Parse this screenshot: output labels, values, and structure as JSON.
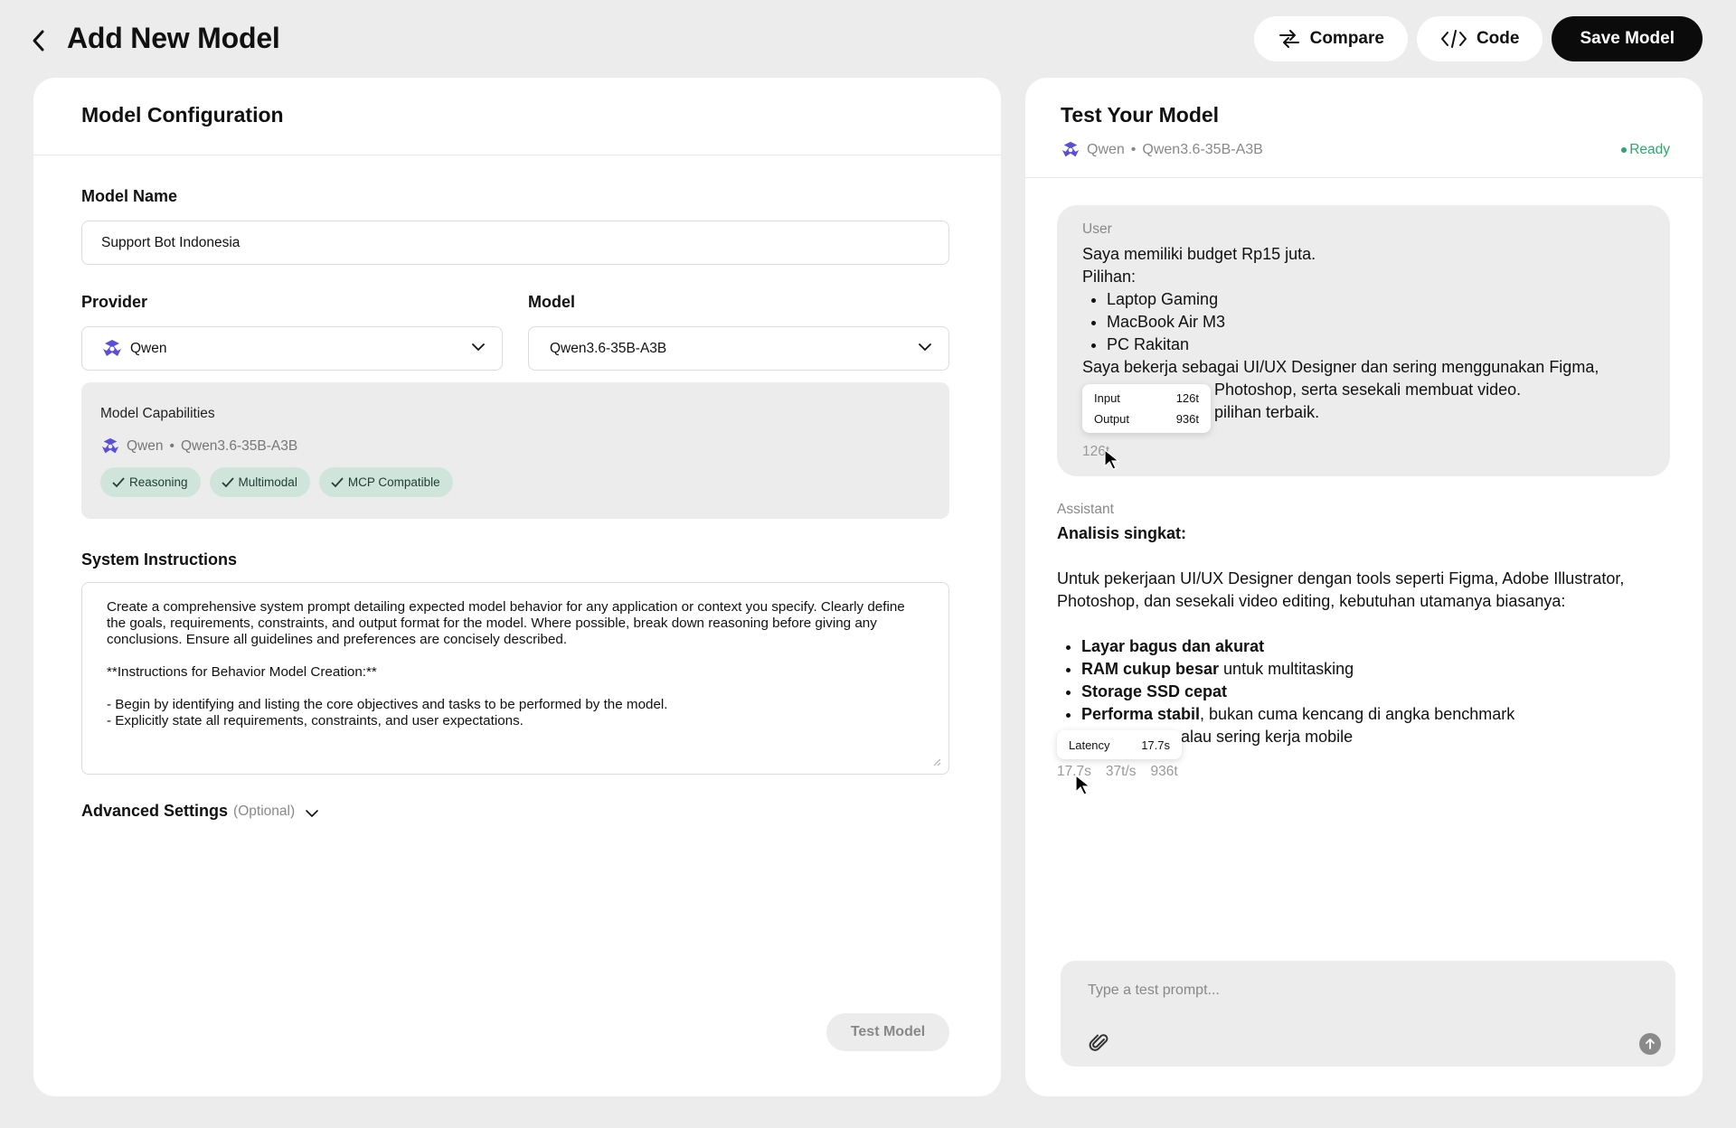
{
  "header": {
    "title": "Add New Model",
    "back_icon": "chevron-left-icon",
    "compare_label": "Compare",
    "code_label": "Code",
    "save_label": "Save Model"
  },
  "config": {
    "panel_title": "Model Configuration",
    "model_name_label": "Model Name",
    "model_name_value": "Support Bot Indonesia",
    "provider_label": "Provider",
    "provider_value": "Qwen",
    "model_label": "Model",
    "model_value": "Qwen3.6-35B-A3B",
    "capabilities": {
      "title": "Model Capabilities",
      "provider": "Qwen",
      "model": "Qwen3.6-35B-A3B",
      "badges": [
        "Reasoning",
        "Multimodal",
        "MCP Compatible"
      ]
    },
    "system_label": "System Instructions",
    "system_text": "Create a comprehensive system prompt detailing expected model behavior for any application or context you specify. Clearly define the goals, requirements, constraints, and output format for the model. Where possible, break down reasoning before giving any conclusions. Ensure all guidelines and preferences are concisely described.\n\n**Instructions for Behavior Model Creation:**\n\n- Begin by identifying and listing the core objectives and tasks to be performed by the model.\n- Explicitly state all requirements, constraints, and user expectations.",
    "advanced_label": "Advanced Settings",
    "advanced_optional": "(Optional)",
    "test_button": "Test Model"
  },
  "test": {
    "title": "Test Your Model",
    "provider": "Qwen",
    "model": "Qwen3.6-35B-A3B",
    "status": "Ready",
    "user": {
      "role": "User",
      "line1": "Saya memiliki budget Rp15 juta.",
      "line2": "Pilihan:",
      "items": [
        "Laptop Gaming",
        "MacBook Air M3",
        "PC Rakitan"
      ],
      "line3": "Saya bekerja sebagai UI/UX Designer dan sering menggunakan Figma,",
      "line4": "Photoshop, serta sesekali membuat video.",
      "line5": "pilihan terbaik.",
      "tokens": "126t",
      "tooltip": {
        "input_label": "Input",
        "input_value": "126t",
        "output_label": "Output",
        "output_value": "936t"
      }
    },
    "assistant": {
      "role": "Assistant",
      "heading": "Analisis singkat:",
      "para": "Untuk pekerjaan UI/UX Designer dengan tools seperti Figma, Adobe Illustrator, Photoshop, dan sesekali video editing, kebutuhan utamanya biasanya:",
      "bullets": [
        {
          "bold": "Layar bagus dan akurat",
          "rest": ""
        },
        {
          "bold": "RAM cukup besar",
          "rest": " untuk multitasking"
        },
        {
          "bold": "Storage SSD cepat",
          "rest": ""
        },
        {
          "bold": "Performa stabil",
          "rest": ", bukan cuma kencang di angka benchmark"
        }
      ],
      "partial_line": "alau sering kerja mobile",
      "stats": {
        "latency": "17.7s",
        "speed": "37t/s",
        "tokens": "936t"
      },
      "tooltip": {
        "label": "Latency",
        "value": "17.7s"
      }
    },
    "input_placeholder": "Type a test prompt..."
  },
  "colors": {
    "accent_dark": "#0b0b0b",
    "ready": "#2aa86a",
    "badge_bg": "#cfe5dc",
    "qwen_logo": "#5b4fd8"
  }
}
